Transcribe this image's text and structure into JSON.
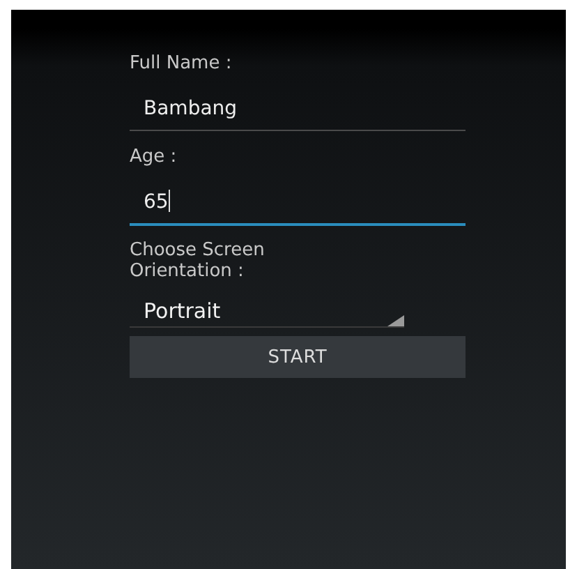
{
  "form": {
    "fields": [
      {
        "label": "Full Name :",
        "value": "Bambang",
        "focused": false
      },
      {
        "label": "Age :",
        "value": "65",
        "focused": true
      }
    ],
    "orientation": {
      "label": "Choose Screen Orientation :",
      "value": "Portrait"
    },
    "button": "START"
  }
}
